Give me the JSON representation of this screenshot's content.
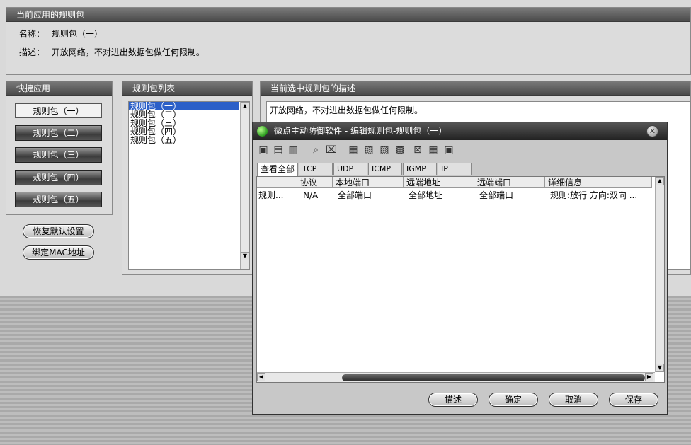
{
  "current_package": {
    "title": "当前应用的规则包",
    "name_label": "名称：",
    "name_value": "规则包（一）",
    "desc_label": "描述：",
    "desc_value": "开放网络，不对进出数据包做任何限制。"
  },
  "quick_apply": {
    "title": "快捷应用",
    "buttons": [
      "规则包（一）",
      "规则包（二）",
      "规则包（三）",
      "规则包（四）",
      "规则包（五）"
    ],
    "active_index": 0,
    "restore_label": "恢复默认设置",
    "bind_mac_label": "绑定MAC地址"
  },
  "package_list": {
    "title": "规则包列表",
    "items": [
      "规则包（一）",
      "规则包（二）",
      "规则包（三）",
      "规则包（四）",
      "规则包（五）"
    ],
    "selected_index": 0
  },
  "selected_desc": {
    "title": "当前选中规则包的描述",
    "text": "开放网络，不对进出数据包做任何限制。"
  },
  "dialog": {
    "title": "微点主动防御软件 - 编辑规则包-规则包（一）",
    "close_glyph": "✕",
    "tabs": [
      "查看全部",
      "TCP",
      "UDP",
      "ICMP",
      "IGMP",
      "IP"
    ],
    "active_tab": 0,
    "columns": [
      "",
      "协议",
      "本地端口",
      "远端地址",
      "远端端口",
      "详细信息"
    ],
    "rows": [
      [
        "规则...",
        "N/A",
        "全部端口",
        "全部地址",
        "全部端口",
        "规则:放行 方向:双向 ..."
      ]
    ],
    "buttons": {
      "describe": "描述",
      "ok": "确定",
      "cancel": "取消",
      "save": "保存"
    },
    "toolbar_icons": [
      "add-rule-icon",
      "edit-rule-icon",
      "delete-rule-icon",
      "search-icon",
      "search-remove-icon",
      "import-icon",
      "export-icon",
      "move-up-icon",
      "move-down-icon",
      "copy-icon",
      "paste-icon",
      "settings-icon"
    ]
  }
}
